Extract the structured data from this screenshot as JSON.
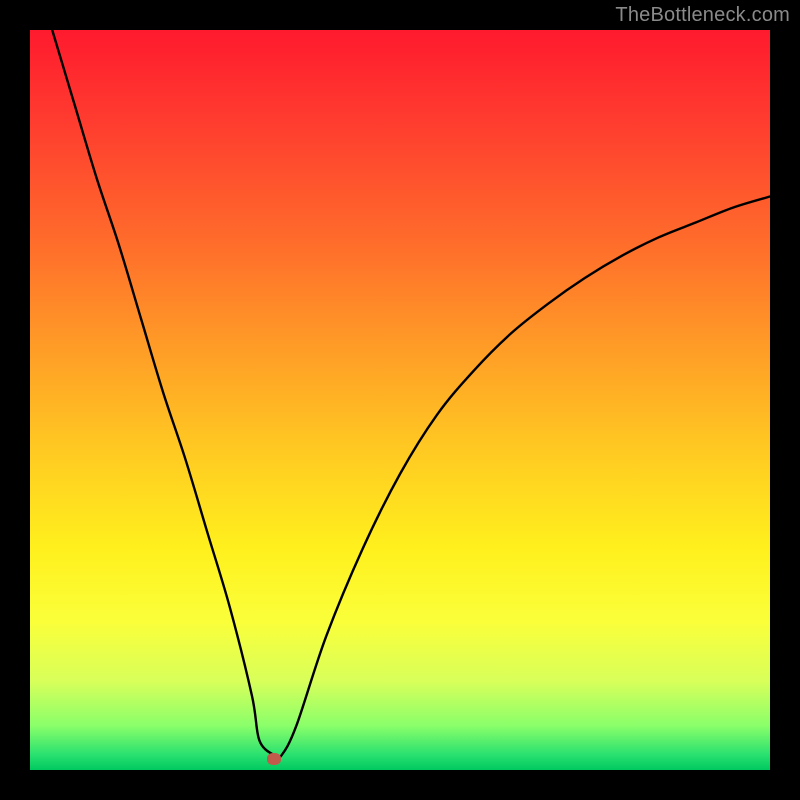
{
  "watermark": "TheBottleneck.com",
  "colors": {
    "frame": "#000000",
    "gradient_top": "#ff1a2e",
    "gradient_mid": "#ffe633",
    "gradient_bottom": "#00c95f",
    "curve": "#000000",
    "marker": "#c05a4a"
  },
  "chart_data": {
    "type": "line",
    "title": "",
    "xlabel": "",
    "ylabel": "",
    "xlim": [
      0,
      100
    ],
    "ylim": [
      0,
      100
    ],
    "legend": false,
    "grid": false,
    "series": [
      {
        "name": "bottleneck-curve",
        "x": [
          3,
          6,
          9,
          12,
          15,
          18,
          21,
          24,
          27,
          30,
          31,
          33,
          34,
          36,
          40,
          45,
          50,
          55,
          60,
          65,
          70,
          75,
          80,
          85,
          90,
          95,
          100
        ],
        "y": [
          100,
          90,
          80,
          71,
          61,
          51,
          42,
          32,
          22,
          10,
          4,
          2,
          2,
          6,
          18,
          30,
          40,
          48,
          54,
          59,
          63,
          66.5,
          69.5,
          72,
          74,
          76,
          77.5
        ]
      }
    ],
    "annotations": [
      {
        "name": "min-point-marker",
        "x": 33,
        "y": 1.5
      }
    ]
  }
}
